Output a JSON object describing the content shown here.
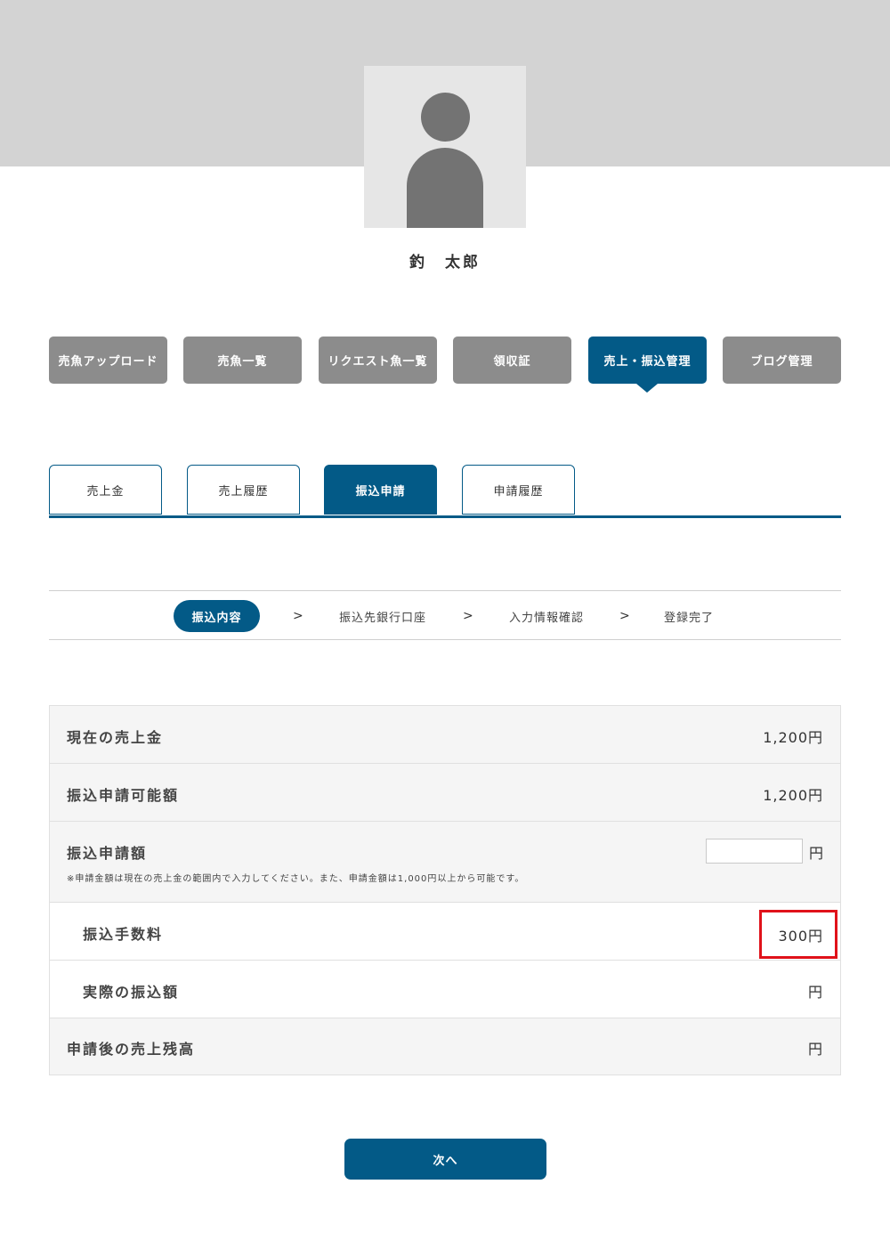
{
  "profile": {
    "name": "釣　太郎"
  },
  "main_nav": {
    "items": [
      {
        "label": "売魚アップロード"
      },
      {
        "label": "売魚一覧"
      },
      {
        "label": "リクエスト魚一覧"
      },
      {
        "label": "領収証"
      },
      {
        "label": "売上・振込管理"
      },
      {
        "label": "ブログ管理"
      }
    ],
    "active_index": 4
  },
  "sub_tabs": {
    "items": [
      {
        "label": "売上金"
      },
      {
        "label": "売上履歴"
      },
      {
        "label": "振込申請"
      },
      {
        "label": "申請履歴"
      }
    ],
    "active_index": 2
  },
  "steps": {
    "items": [
      {
        "label": "振込内容"
      },
      {
        "label": "振込先銀行口座"
      },
      {
        "label": "入力情報確認"
      },
      {
        "label": "登録完了"
      }
    ],
    "separator": ">",
    "active_index": 0
  },
  "form": {
    "current_sales": {
      "label": "現在の売上金",
      "value": "1,200円"
    },
    "available_amount": {
      "label": "振込申請可能額",
      "value": "1,200円"
    },
    "request_amount": {
      "label": "振込申請額",
      "input_value": "",
      "unit": "円",
      "note": "※申請金額は現在の売上金の範囲内で入力してください。また、申請金額は1,000円以上から可能です。"
    },
    "fee": {
      "label": "振込手数料",
      "value": "300円"
    },
    "actual_transfer": {
      "label": "実際の振込額",
      "value": "円"
    },
    "remaining_balance": {
      "label": "申請後の売上残高",
      "value": "円"
    }
  },
  "buttons": {
    "next_label": "次へ"
  },
  "colors": {
    "accent": "#035a87",
    "nav_inactive": "#8c8c8c",
    "header_band": "#d3d3d3",
    "highlight": "#e0121a"
  }
}
